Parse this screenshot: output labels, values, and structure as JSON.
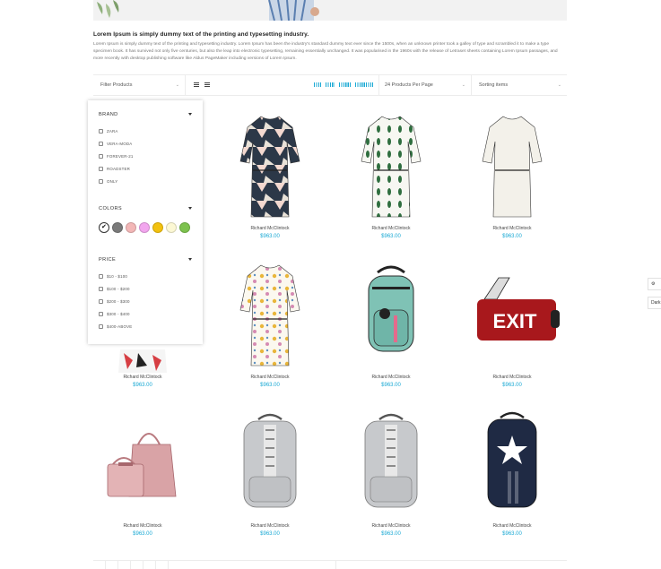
{
  "intro": {
    "title": "Lorem Ipsum is simply dummy text of the printing and typesetting industry.",
    "text": "Lorem Ipsum is simply dummy text of the printing and typesetting industry. Lorem Ipsum has been the industry's standard dummy text ever since the 1500s, when an unknown printer took a galley of type and scrambled it to make a type specimen book. It has survived not only five centuries, but also the leap into electronic typesetting, remaining essentially unchanged. It was popularised in the 1960s with the release of Letraset sheets containing Lorem Ipsum passages, and more recently with desktop publishing software like Aldus PageMaker including versions of Lorem Ipsum."
  },
  "toolbar": {
    "filter_label": "Filter Products",
    "per_page": "24 Products Per Page",
    "sort": "Sorting items"
  },
  "filters": {
    "brand": {
      "title": "BRAND",
      "options": [
        "ZARA",
        "VERA-MODA",
        "FOREVER-21",
        "ROADSTER",
        "ONLY"
      ]
    },
    "colors": {
      "title": "COLORS",
      "swatches": [
        "#ffffff",
        "#7a7a7a",
        "#f3b7b7",
        "#f2a6ee",
        "#f2c10f",
        "#fcf8d4",
        "#7dc24e"
      ]
    },
    "price": {
      "title": "PRICE",
      "options": [
        "$10 - $100",
        "$100 - $200",
        "$200 - $300",
        "$300 - $400",
        "$400-ABOVE"
      ]
    }
  },
  "products": [
    {
      "name": "Richard McClintock",
      "price": "$963.00",
      "kind": "dress-navy"
    },
    {
      "name": "Richard McClintock",
      "price": "$963.00",
      "kind": "dress-leaf"
    },
    {
      "name": "Richard McClintock",
      "price": "$963.00",
      "kind": "dress-white"
    },
    {
      "name": "Richard McClintock",
      "price": "$963.00",
      "kind": "dress-print"
    },
    {
      "name": "Richard McClintock",
      "price": "$963.00",
      "kind": "dress-floral"
    },
    {
      "name": "Richard McClintock",
      "price": "$963.00",
      "kind": "backpack-mint"
    },
    {
      "name": "Richard McClintock",
      "price": "$963.00",
      "kind": "bag-exit"
    },
    {
      "name": "Richard McClintock",
      "price": "$963.00",
      "kind": "handbag-pink"
    },
    {
      "name": "Richard McClintock",
      "price": "$963.00",
      "kind": "backpack-grey"
    },
    {
      "name": "Richard McClintock",
      "price": "$963.00",
      "kind": "backpack-grey"
    },
    {
      "name": "Richard McClintock",
      "price": "$963.00",
      "kind": "backpack-navy"
    }
  ],
  "exit_sign": "EXIT",
  "side_tabs": {
    "settings_icon": "gear-icon",
    "dark_label": "Dark"
  },
  "colors": {
    "accent": "#1aa9d4",
    "exit_bag": "#a8181c"
  }
}
